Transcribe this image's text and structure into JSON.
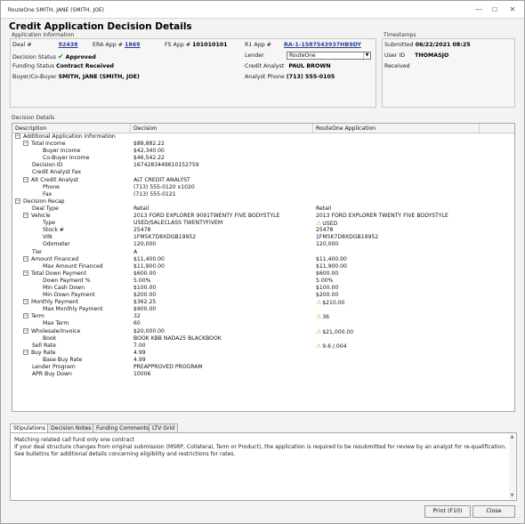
{
  "window": {
    "title": "RouteOne SMITH, JANE (SMITH, JOE)"
  },
  "heading": "Credit Application Decision Details",
  "app_info": {
    "group_label": "Application Information",
    "deal_label": "Deal #",
    "deal_value": "92438",
    "era_label": "ERA App #",
    "era_value": "1869",
    "fs_label": "FS App #",
    "fs_value": "101010101",
    "decision_status_label": "Decision Status",
    "decision_status_value": "Approved",
    "funding_status_label": "Funding Status",
    "funding_status_value": "Contract Received",
    "buyer_label": "Buyer/Co-Buyer",
    "buyer_value": "SMITH, JANE (SMITH, JOE)",
    "r1_label": "R1 App #",
    "r1_value": "RA-1-1587543937HB9DY",
    "lender_label": "Lender",
    "lender_value": "RouteOne",
    "analyst_label": "Credit Analyst",
    "analyst_value": "PAUL BROWN",
    "phone_label": "Analyst Phone",
    "phone_value": "(713) 555-0105"
  },
  "timestamps": {
    "group_label": "Timestamps",
    "submitted_label": "Submitted",
    "submitted_value": "06/22/2021 08:25",
    "user_label": "User ID",
    "user_value": "THOMASJO",
    "received_label": "Received"
  },
  "decision_details": {
    "label": "Decision Details",
    "columns": [
      "Description",
      "Decision",
      "RouteOne Application"
    ],
    "rows": [
      {
        "indent": 0,
        "exp": "minus",
        "desc": "Additional Application Information",
        "decision": "",
        "app": ""
      },
      {
        "indent": 1,
        "exp": "minus",
        "desc": "Total Income",
        "decision": "$88,882.22",
        "app": ""
      },
      {
        "indent": 2,
        "desc": "Buyer Income",
        "decision": "$42,340.00",
        "app": ""
      },
      {
        "indent": 2,
        "desc": "Co-Buyer Income",
        "decision": "$46,542.22",
        "app": ""
      },
      {
        "indent": 1,
        "desc": "Decision ID",
        "decision": "1674283449610152759",
        "app": ""
      },
      {
        "indent": 1,
        "desc": "Credit Analyst Fax",
        "decision": "",
        "app": ""
      },
      {
        "indent": 1,
        "exp": "minus",
        "desc": "Alt Credit Analyst",
        "decision": "ALT CREDIT ANALYST",
        "app": ""
      },
      {
        "indent": 2,
        "desc": "Phone",
        "decision": "(713) 555-0120 x1020",
        "app": ""
      },
      {
        "indent": 2,
        "desc": "Fax",
        "decision": "(713) 555-0121",
        "app": ""
      },
      {
        "indent": 0,
        "exp": "minus",
        "desc": "Decision Recap",
        "decision": "",
        "app": ""
      },
      {
        "indent": 1,
        "desc": "Deal Type",
        "decision": "Retail",
        "app": "Retail"
      },
      {
        "indent": 1,
        "exp": "minus",
        "desc": "Vehicle",
        "decision": "2013 FORD EXPLORER 9091TWENTY FIVE BODYSTYLE",
        "app": "2013 FORD EXPLORER TWENTY FIVE BODYSTYLE"
      },
      {
        "indent": 2,
        "desc": "Type",
        "decision": "USED/SALECLASS TWENTYFIVEM",
        "app": "USED",
        "warn": true
      },
      {
        "indent": 2,
        "desc": "Stock #",
        "decision": "25478",
        "app": "25478"
      },
      {
        "indent": 2,
        "desc": "VIN",
        "decision": "1FM5K7D8XDGB19952",
        "app": "1FM5K7D8XDGB19952"
      },
      {
        "indent": 2,
        "desc": "Odometer",
        "decision": "120,000",
        "app": "120,000"
      },
      {
        "indent": 1,
        "desc": "Tier",
        "decision": "A",
        "app": ""
      },
      {
        "indent": 1,
        "exp": "minus",
        "desc": "Amount Financed",
        "decision": "$11,400.00",
        "app": "$11,400.00"
      },
      {
        "indent": 2,
        "desc": "Max Amount Financed",
        "decision": "$11,900.00",
        "app": "$11,900.00"
      },
      {
        "indent": 1,
        "exp": "minus",
        "desc": "Total Down Payment",
        "decision": "$600.00",
        "app": "$600.00"
      },
      {
        "indent": 2,
        "desc": "Down Payment %",
        "decision": "5.00%",
        "app": "5.00%"
      },
      {
        "indent": 2,
        "desc": "Min Cash Down",
        "decision": "$100.00",
        "app": "$100.00"
      },
      {
        "indent": 2,
        "desc": "Min Down Payment",
        "decision": "$200.00",
        "app": "$200.00"
      },
      {
        "indent": 1,
        "exp": "minus",
        "desc": "Monthly Payment",
        "decision": "$362.25",
        "app": "$210.00",
        "warn": true
      },
      {
        "indent": 2,
        "desc": "Max Monthly Payment",
        "decision": "$900.00",
        "app": ""
      },
      {
        "indent": 1,
        "exp": "minus",
        "desc": "Term",
        "decision": "32",
        "app": "36",
        "warn": true
      },
      {
        "indent": 2,
        "desc": "Max Term",
        "decision": "60",
        "app": ""
      },
      {
        "indent": 1,
        "exp": "minus",
        "desc": "Wholesale/Invoice",
        "decision": "$20,000.00",
        "app": "$21,000.00",
        "warn": true
      },
      {
        "indent": 2,
        "desc": "Book",
        "decision": "BOOK KBB NADA25 BLACKBOOK",
        "app": ""
      },
      {
        "indent": 1,
        "desc": "Sell Rate",
        "decision": "7.00",
        "app": "9.6 /.004",
        "warn": true
      },
      {
        "indent": 1,
        "exp": "minus",
        "desc": "Buy Rate",
        "decision": "4.99",
        "app": ""
      },
      {
        "indent": 2,
        "desc": "Base Buy Rate",
        "decision": "4.99",
        "app": ""
      },
      {
        "indent": 1,
        "desc": "Lender Program",
        "decision": "PREAPPROVED PROGRAM",
        "app": ""
      },
      {
        "indent": 1,
        "desc": "APR Buy Down",
        "decision": "10006",
        "app": ""
      }
    ]
  },
  "tabs": [
    "Stipulations",
    "Decision Notes",
    "Funding Comments",
    "LTV Grid"
  ],
  "stipulations_text": {
    "line1": "Matching related call fund only one contract",
    "line2": "If your deal structure changes from original submission (MSRP, Collateral, Term or Product), the application is required to be resubmitted for review by an analyst for re-qualification.  See bulletins for additional details concerning eligibility and restrictions for rates."
  },
  "buttons": {
    "print": "Print (F10)",
    "close": "Close"
  },
  "colors": {
    "link": "#1a3fc8",
    "check": "#1a9a1a",
    "warning": "#e6a300"
  }
}
